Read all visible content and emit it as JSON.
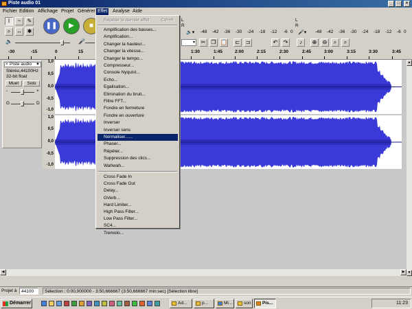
{
  "window": {
    "title": "Piste audio 01"
  },
  "menubar": [
    "Fichier",
    "Edition",
    "Affichage",
    "Projet",
    "Générer",
    "Effet",
    "Analyse",
    "Aide"
  ],
  "meters": {
    "L": "L",
    "R": "R",
    "scale": [
      "-48",
      "-42",
      "-36",
      "-30",
      "-24",
      "-18",
      "-12",
      "-6",
      "0"
    ]
  },
  "timeline": [
    "-30",
    "-15",
    "0",
    "15",
    "30",
    "45",
    "1:00",
    "1:15",
    "1:30",
    "1:45",
    "2:00",
    "2:15",
    "2:30",
    "2:45",
    "3:00",
    "3:15",
    "3:30",
    "3:45"
  ],
  "track": {
    "name": "Piste audio",
    "format": "Stéréo,44100Hz",
    "bits": "32-bit float",
    "mute": "Muet",
    "solo": "Solo",
    "gain_minus": "-",
    "gain_plus": "+",
    "pan_left": "G",
    "pan_right": "D",
    "scale": [
      "1,0",
      "0,5",
      "0,0",
      "-0,5",
      "-1,0"
    ]
  },
  "effect_menu": {
    "repeat_last": "Répéter le dernier effet",
    "repeat_shortcut": "Ctrl+R",
    "group1": [
      "Amplification des basses...",
      "Amplification...",
      "Changer la hauteur...",
      "Changer la vitesse...",
      "Changer le tempo...",
      "Compresseur...",
      "Console Nyquist...",
      "Echo...",
      "Egalisation...",
      "Elimination du bruit...",
      "Filtre FFT...",
      "Fondre en fermeture",
      "Fondre en ouverture",
      "Inverser",
      "Inverser sens",
      "Normaliser......",
      "Phaser...",
      "Répéter...",
      "Suppression des clics...",
      "Wahwah..."
    ],
    "group2": [
      "Cross Fade In",
      "Cross Fade Out",
      "Delay...",
      "GVerb...",
      "Hard Limiter...",
      "High Pass Filter...",
      "Low Pass Filter...",
      "SC4...",
      "Tremolo..."
    ],
    "highlighted": "Normaliser......"
  },
  "status": {
    "rate_label": "Projet à",
    "rate_value": "44100",
    "selection": "Sélection : 0:00,000000 - 3:50,666667 (3:50,666667 min:sec)   [Sélection libre]"
  },
  "taskbar": {
    "start": "Démarrer",
    "tasks": [
      "Ad...",
      "p...",
      "Mi...",
      "...",
      "son",
      "Pis..."
    ],
    "clock": "11:23"
  },
  "colors": {
    "waveform": "#3a3ad8",
    "waveform_peak": "#2020a8",
    "selection": "#0a246a"
  }
}
